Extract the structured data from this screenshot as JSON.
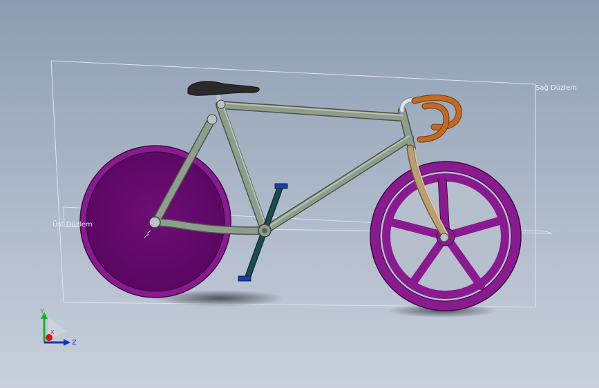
{
  "viewport": {
    "planes": {
      "right_plane_label": "Sağ Düzlem",
      "top_plane_label": "Üst Düzlem"
    },
    "triad": {
      "y_label": "Y",
      "z_label": "Z",
      "x_label": "X"
    }
  },
  "colors": {
    "background_top": "#8d9cb2",
    "background_bottom": "#c9d0dc",
    "frame": "#8e9e8c",
    "wheels": "#8a1a8f",
    "handlebar": "#c36a22",
    "fork": "#b9a070",
    "saddle": "#2a2a2a",
    "crank": "#1e4d50",
    "axis_y": "#16b22a",
    "axis_z": "#1530c8",
    "axis_x": "#d01818"
  }
}
